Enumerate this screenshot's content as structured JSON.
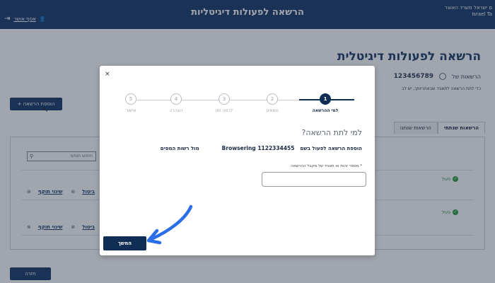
{
  "header": {
    "title": "הרשאה לפעולות דיגיטליות",
    "org_line1": "ם ישראל משרד האוצר",
    "org_line2": "Israel Ta",
    "user_label": "אסף אושר",
    "bg_color": "#16396a"
  },
  "page": {
    "title": "הרשאה לפעולות דיגיטלית",
    "registration_label": "הרשאות של",
    "registration_number": "123456789",
    "hint": "כדי לתת הרשאה לתאגיד שבאחריותך, יש לב",
    "add_button": "הוספת הרשאה +",
    "tabs": [
      "הרשאות שנתתי",
      "הרשאות שנתנו"
    ],
    "search_placeholder": "חיפוש חופשי",
    "rows": [
      {
        "status": "פעיל",
        "cancel": "ביטול",
        "change": "שינוי תוקף"
      },
      {
        "status": "פעיל",
        "cancel": "ביטול",
        "change": "שינוי תוקף"
      }
    ],
    "back_button": "חזרה"
  },
  "modal": {
    "close_icon": "×",
    "steps": [
      {
        "num": "1",
        "label": "למי ההרשאה"
      },
      {
        "num": "2",
        "label": "נושאים"
      },
      {
        "num": "3",
        "label": "לכמה זמן"
      },
      {
        "num": "4",
        "label": "הצהרה"
      },
      {
        "num": "5",
        "label": "אישור"
      }
    ],
    "question": "למי לתת הרשאה?",
    "summary_for": "הוספת הרשאה לפעול בשם",
    "summary_name": "1122334455 Browsering",
    "summary_vs": "מול רשות המסים",
    "field_label": "* מספר זהות או תאגיד של מקבל ההרשאה",
    "field_value": "",
    "continue_button": "המשך"
  },
  "colors": {
    "primary": "#0f2d55",
    "annotation_arrow": "#2b6ee8",
    "status_green": "#2e9e46"
  }
}
